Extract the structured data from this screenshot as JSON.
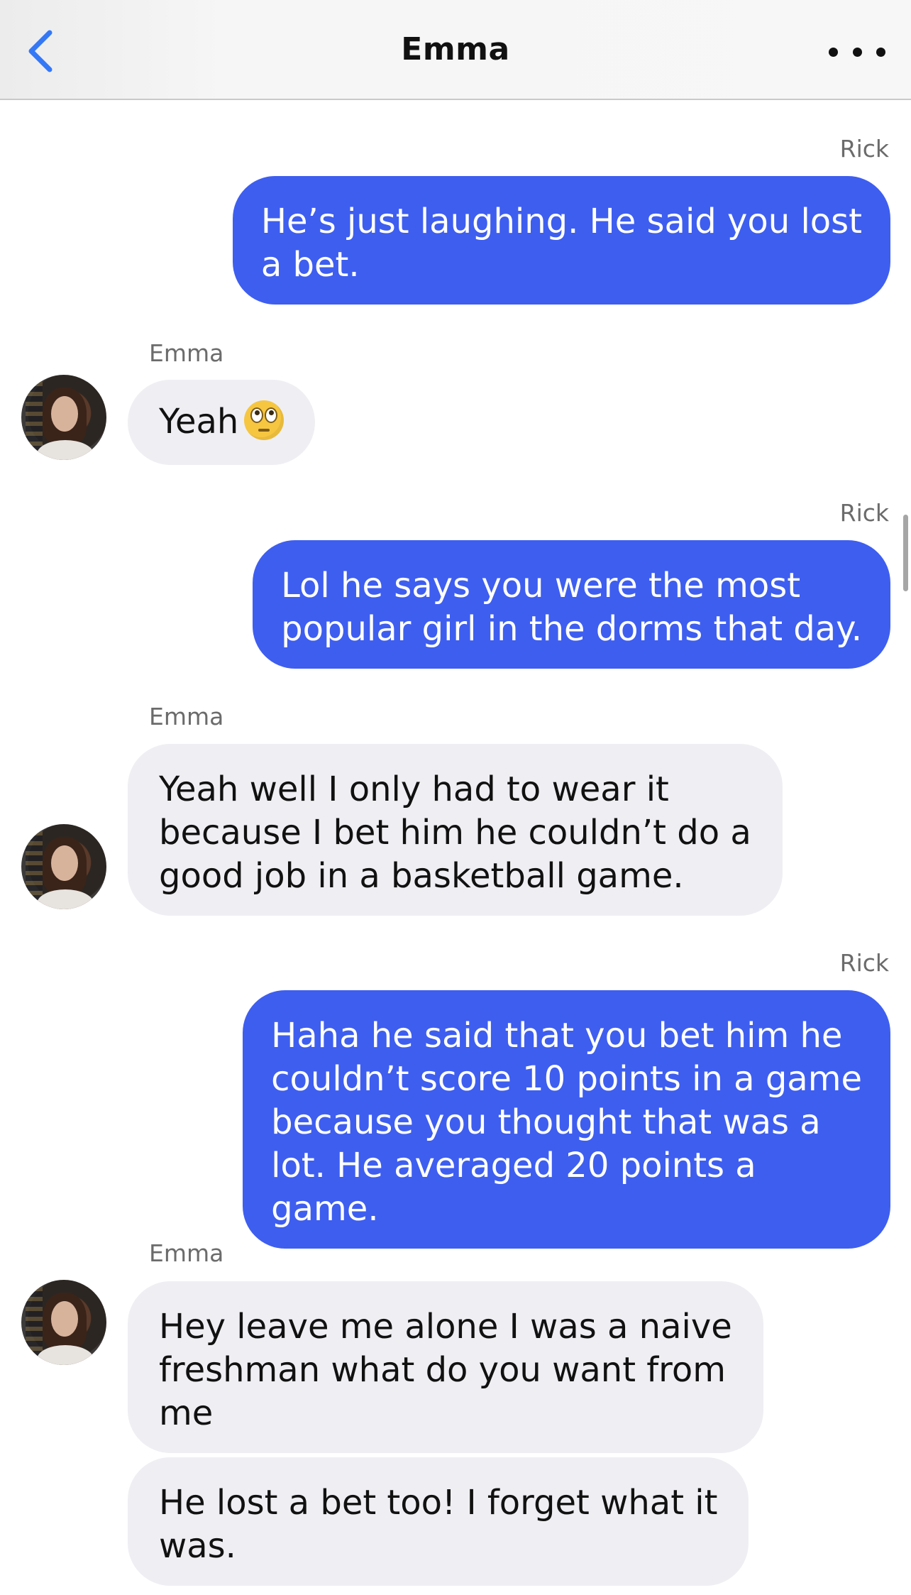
{
  "header": {
    "title": "Emma"
  },
  "messages": [
    {
      "sender": "Rick",
      "direction": "outgoing",
      "lines": [
        "He’s just laughing. He said you lost",
        "a bet."
      ]
    },
    {
      "sender": "Emma",
      "direction": "incoming",
      "lines": [
        "Yeah"
      ],
      "emoji": "face-with-rolling-eyes"
    },
    {
      "sender": "Rick",
      "direction": "outgoing",
      "lines": [
        "Lol he says you were the most",
        "popular girl in the dorms that day."
      ]
    },
    {
      "sender": "Emma",
      "direction": "incoming",
      "lines": [
        "Yeah well I only had to wear it",
        "because I bet him he couldn’t do a",
        "good job in a basketball game."
      ]
    },
    {
      "sender": "Rick",
      "direction": "outgoing",
      "lines": [
        "Haha he said that you bet him he",
        "couldn’t score 10 points in a game",
        "because you thought that was a",
        "lot. He averaged 20 points a",
        "game."
      ]
    },
    {
      "sender": "Emma",
      "direction": "incoming",
      "lines": [
        "Hey leave me alone I was a naive",
        "freshman what do you want from",
        "me"
      ]
    },
    {
      "sender": "Emma",
      "direction": "incoming",
      "lines": [
        "He lost a bet too! I forget what it",
        "was."
      ]
    }
  ],
  "colors": {
    "outgoing_bubble": "#3e5ef0",
    "incoming_bubble": "#efeff3",
    "back_chevron": "#3478f6"
  },
  "icons": {
    "back": "chevron-left-icon",
    "more": "ellipsis-icon"
  }
}
